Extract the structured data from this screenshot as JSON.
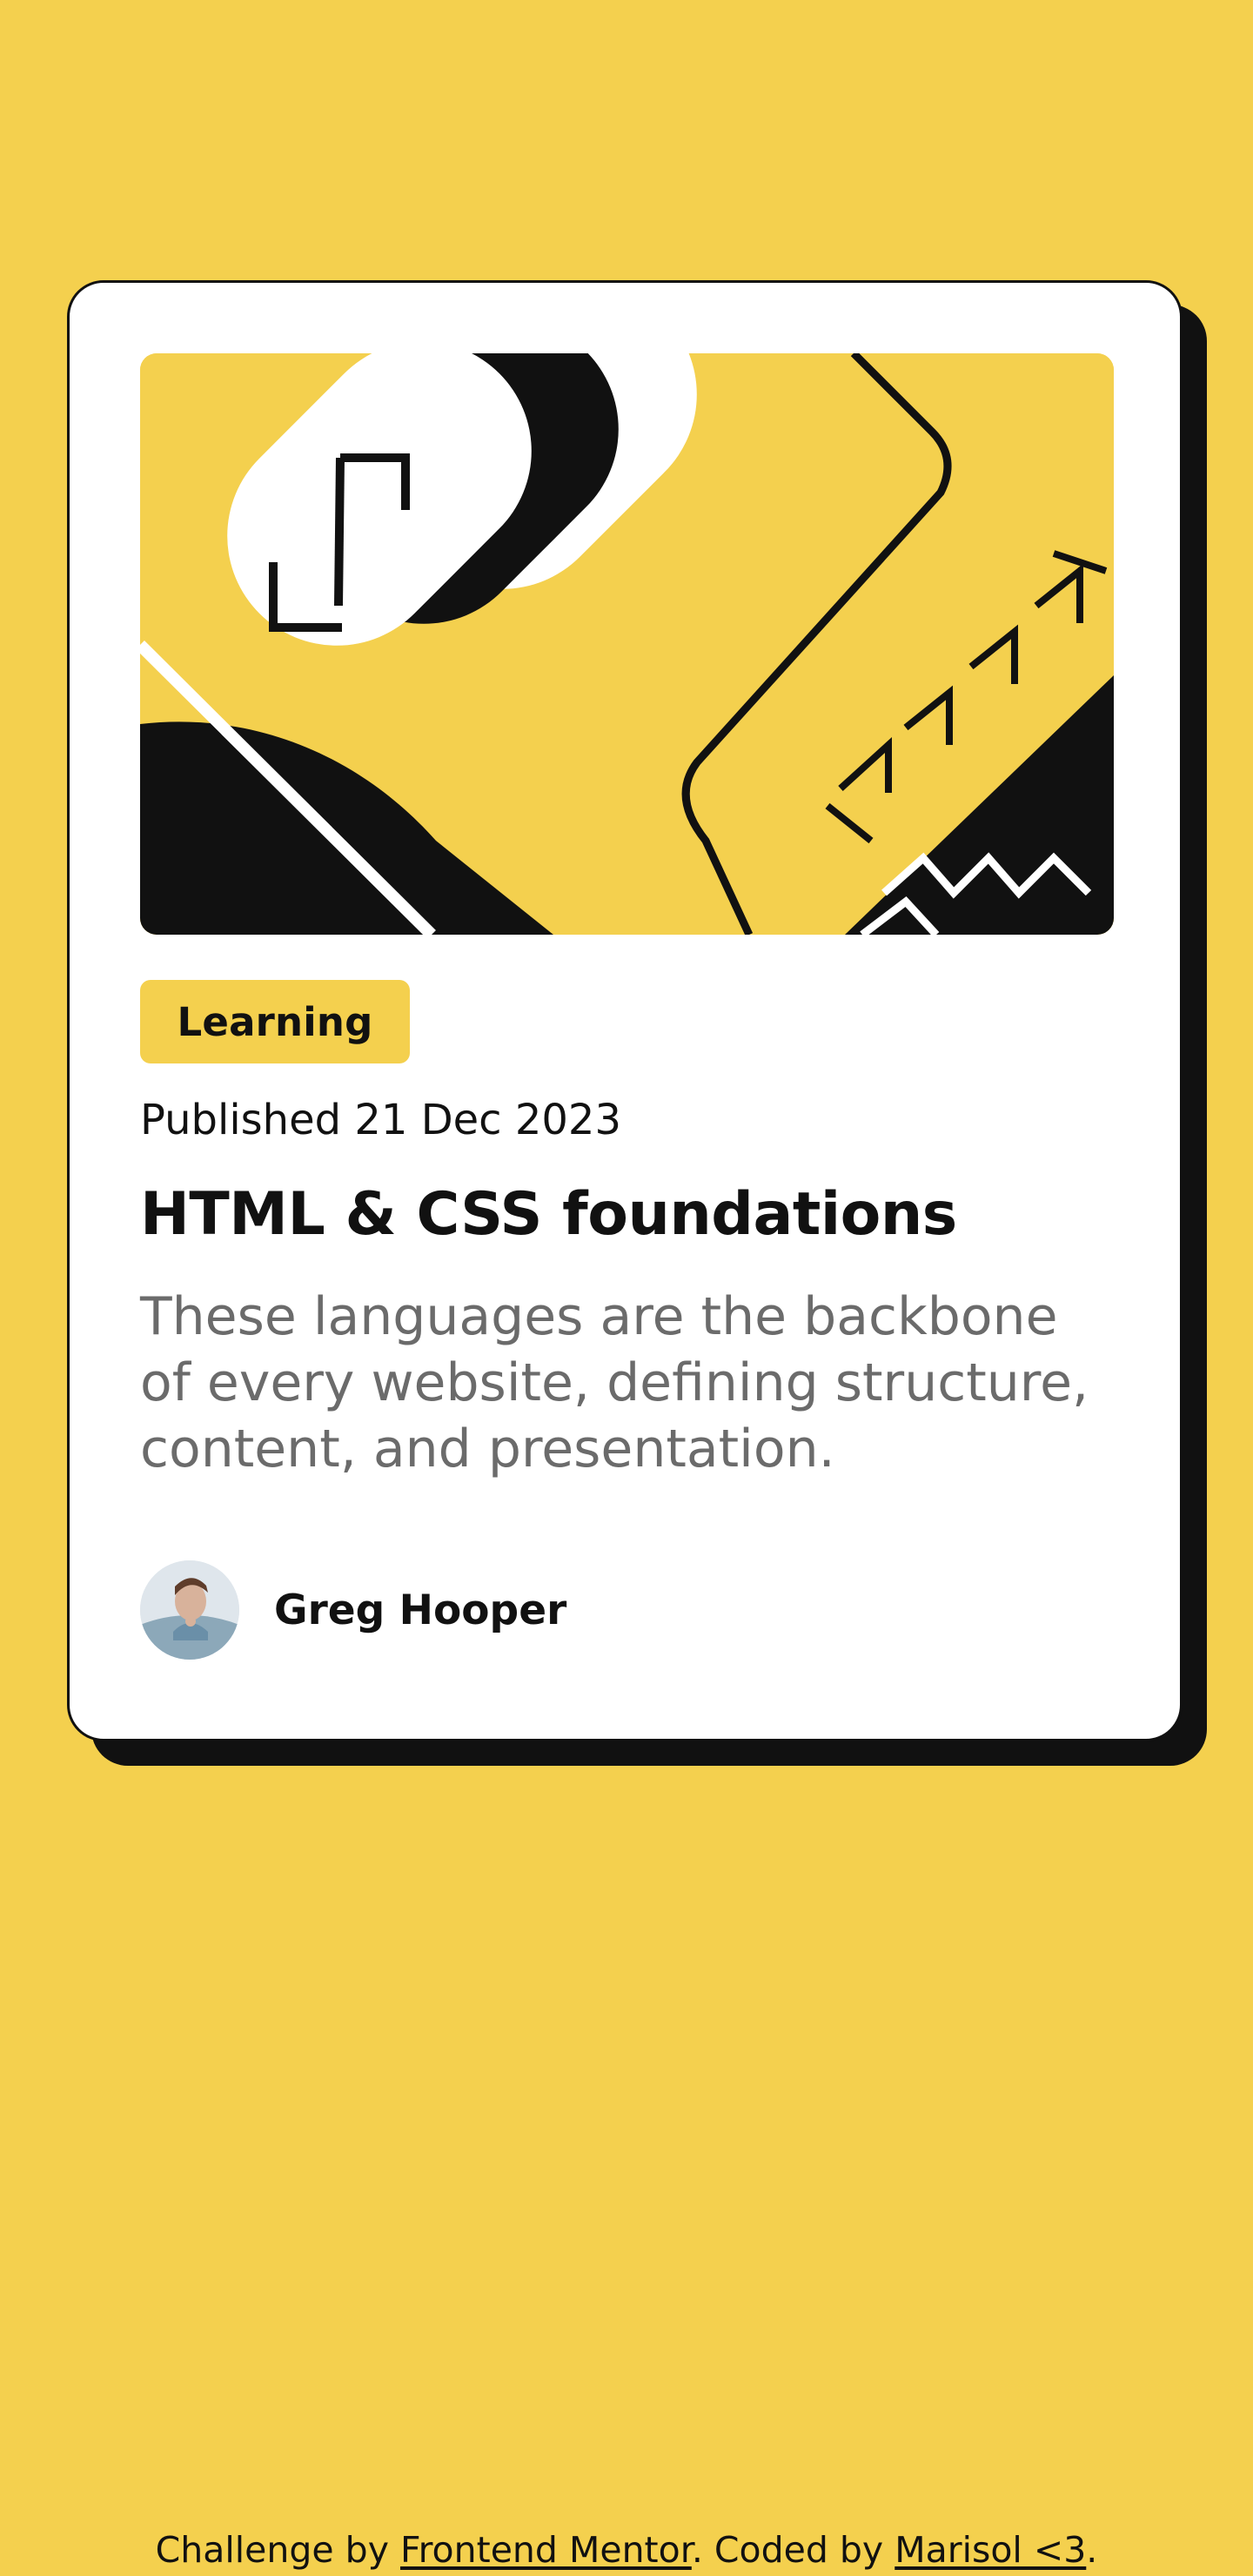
{
  "card": {
    "tag": "Learning",
    "published": "Published 21 Dec 2023",
    "title": "HTML & CSS foundations",
    "description": "These languages are the backbone of every website, defining structure, content, and presentation.",
    "author": {
      "name": "Greg Hooper",
      "avatar_icon": "author-avatar"
    },
    "illustration_icon": "abstract-geometric-illustration"
  },
  "footer": {
    "prefix": "Challenge by ",
    "link1": "Frontend Mentor",
    "middle": ". Coded by ",
    "link2": "Marisol <3",
    "suffix": "."
  },
  "colors": {
    "background": "#f4d04e",
    "card": "#ffffff",
    "text": "#111111",
    "muted_text": "#6b6b6b"
  }
}
